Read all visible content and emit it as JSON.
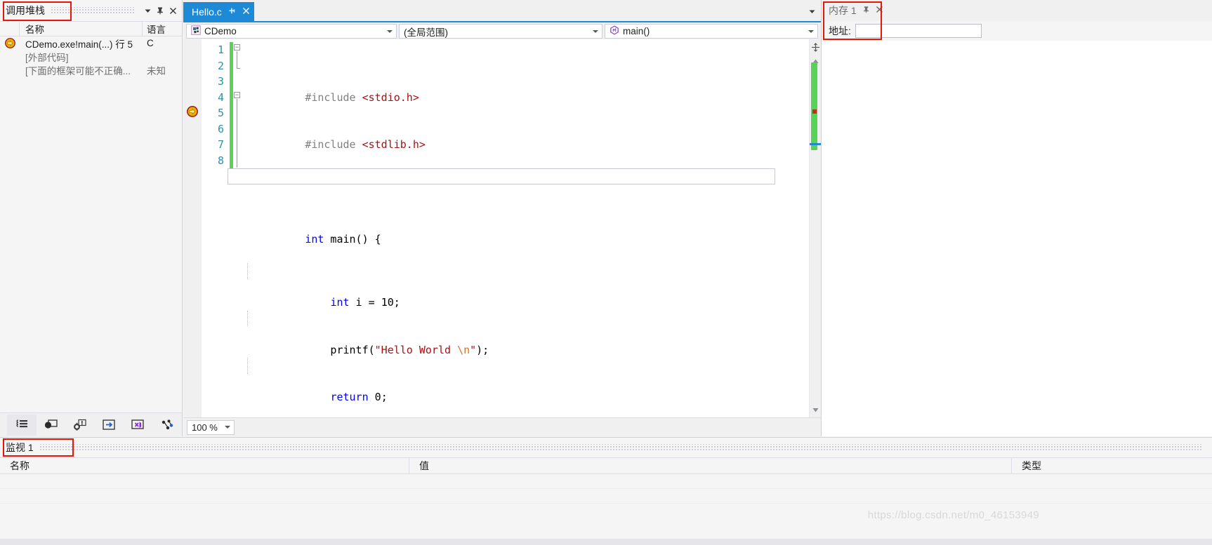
{
  "call_stack": {
    "title": "调用堆栈",
    "columns": {
      "name": "名称",
      "language": "语言"
    },
    "rows": [
      {
        "name": "CDemo.exe!main(...) 行 5",
        "language": "C",
        "icon": "yellow-arrow-icon",
        "muted": false
      },
      {
        "name": "[外部代码]",
        "language": "",
        "icon": "",
        "muted": true
      },
      {
        "name": "[下面的框架可能不正确...",
        "language": "未知",
        "icon": "",
        "muted": true
      }
    ],
    "titlebar_buttons": [
      {
        "name": "dropdown-icon",
        "glyph": "▼"
      },
      {
        "name": "pin-icon",
        "glyph": "⊥"
      },
      {
        "name": "close-icon",
        "glyph": "✕"
      }
    ],
    "debug_toolbar": [
      {
        "name": "show-call-stack-icon"
      },
      {
        "name": "breakpoints-icon"
      },
      {
        "name": "exception-settings-icon"
      },
      {
        "name": "go-to-disassembly-icon"
      },
      {
        "name": "open-in-vs-icon"
      },
      {
        "name": "threads-icon"
      }
    ]
  },
  "editor": {
    "tab": {
      "label": "Hello.c",
      "pin_glyph": "⊐",
      "close_glyph": "✕"
    },
    "tabstrip_chevron": "▼",
    "nav": {
      "project": "CDemo",
      "scope": "(全局范围)",
      "member": "main()"
    },
    "zoom_level": "100 %",
    "lines": [
      {
        "n": 1,
        "text": "#include <stdio.h>"
      },
      {
        "n": 2,
        "text": "#include <stdlib.h>"
      },
      {
        "n": 3,
        "text": ""
      },
      {
        "n": 4,
        "text": "int main() {"
      },
      {
        "n": 5,
        "text": "    int i = 10;"
      },
      {
        "n": 6,
        "text": "    printf(\"Hello World \\n\");"
      },
      {
        "n": 7,
        "text": "    return 0;"
      },
      {
        "n": 8,
        "text": "}"
      }
    ],
    "execution_pointer_line": 5,
    "scrollbar": {
      "up_glyph": "▲",
      "down_glyph": "▼",
      "split_glyph": "✛"
    }
  },
  "memory": {
    "tab_label": "内存 1",
    "pin_glyph": "⊥",
    "close_glyph": "✕",
    "address_label": "地址:",
    "address_value": "",
    "address_placeholder": ""
  },
  "watch": {
    "title": "监视 1",
    "columns": {
      "name": "名称",
      "value": "值",
      "type": "类型"
    },
    "rows": []
  },
  "watermark": "https://blog.csdn.net/m0_46153949",
  "colors": {
    "accent": "#1e8ad6",
    "highlight_box": "#e3170a",
    "change_bar": "#57d457",
    "linenum": "#2b91af",
    "keyword": "#0000ff",
    "string": "#a31515",
    "preprocessor": "#808080",
    "escape": "#d3722b"
  }
}
